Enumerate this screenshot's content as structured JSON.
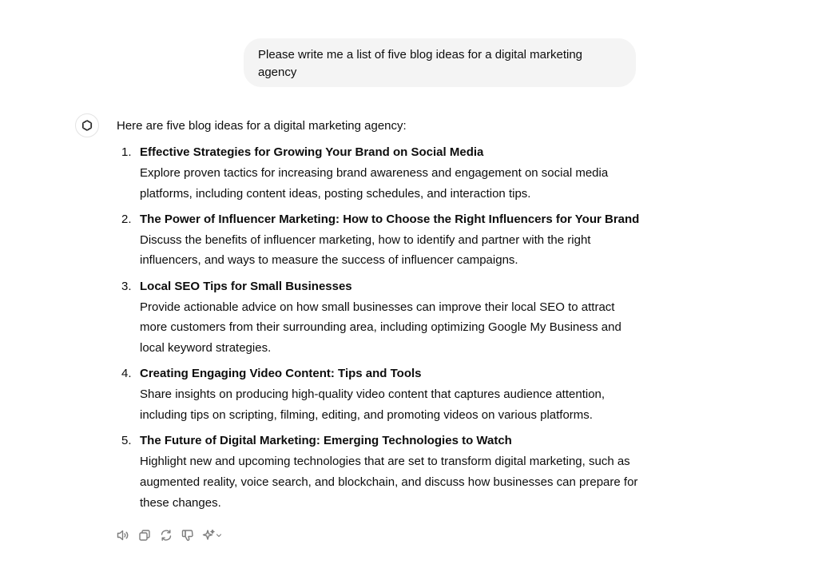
{
  "user_message": {
    "text": "Please write me a list of five blog ideas for a digital marketing agency"
  },
  "assistant": {
    "avatar_icon": "openai-logo-icon",
    "intro": "Here are five blog ideas for a digital marketing agency:",
    "ideas": [
      {
        "number": "1.",
        "title": "Effective Strategies for Growing Your Brand on Social Media",
        "description": "Explore proven tactics for increasing brand awareness and engagement on social media platforms, including content ideas, posting schedules, and interaction tips."
      },
      {
        "number": "2.",
        "title": "The Power of Influencer Marketing: How to Choose the Right Influencers for Your Brand",
        "description": "Discuss the benefits of influencer marketing, how to identify and partner with the right influencers, and ways to measure the success of influencer campaigns."
      },
      {
        "number": "3.",
        "title": "Local SEO Tips for Small Businesses",
        "description": "Provide actionable advice on how small businesses can improve their local SEO to attract more customers from their surrounding area, including optimizing Google My Business and local keyword strategies."
      },
      {
        "number": "4.",
        "title": "Creating Engaging Video Content: Tips and Tools",
        "description": "Share insights on producing high-quality video content that captures audience attention, including tips on scripting, filming, editing, and promoting videos on various platforms."
      },
      {
        "number": "5.",
        "title": "The Future of Digital Marketing: Emerging Technologies to Watch",
        "description": "Highlight new and upcoming technologies that are set to transform digital marketing, such as augmented reality, voice search, and blockchain, and discuss how businesses can prepare for these changes."
      }
    ],
    "action_icons": [
      "read-aloud-icon",
      "copy-icon",
      "regenerate-icon",
      "thumbs-down-icon",
      "model-switch-icon"
    ]
  },
  "colors": {
    "bubble_background": "#f4f4f4",
    "text": "#0d0d0d",
    "icon": "#7d7d7d"
  }
}
